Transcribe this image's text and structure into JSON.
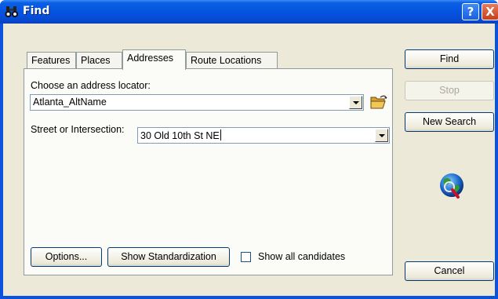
{
  "window": {
    "title": "Find",
    "help_button": "?",
    "close_button": "X"
  },
  "tabs": [
    {
      "label": "Features",
      "active": false
    },
    {
      "label": "Places",
      "active": false
    },
    {
      "label": "Addresses",
      "active": true
    },
    {
      "label": "Route Locations",
      "active": false
    }
  ],
  "addresses": {
    "locator_label": "Choose an address locator:",
    "locator_value": "Atlanta_AltName",
    "street_label": "Street or Intersection:",
    "street_value": "30 Old 10th St NE",
    "options_button": "Options...",
    "standardization_button": "Show Standardization",
    "show_all_label": "Show all candidates",
    "show_all_checked": false
  },
  "side_buttons": {
    "find": "Find",
    "stop": "Stop",
    "new_search": "New Search",
    "cancel": "Cancel"
  },
  "icons": {
    "title": "binoculars-icon",
    "browse": "open-folder-icon",
    "status": "globe-magnifier-icon"
  }
}
